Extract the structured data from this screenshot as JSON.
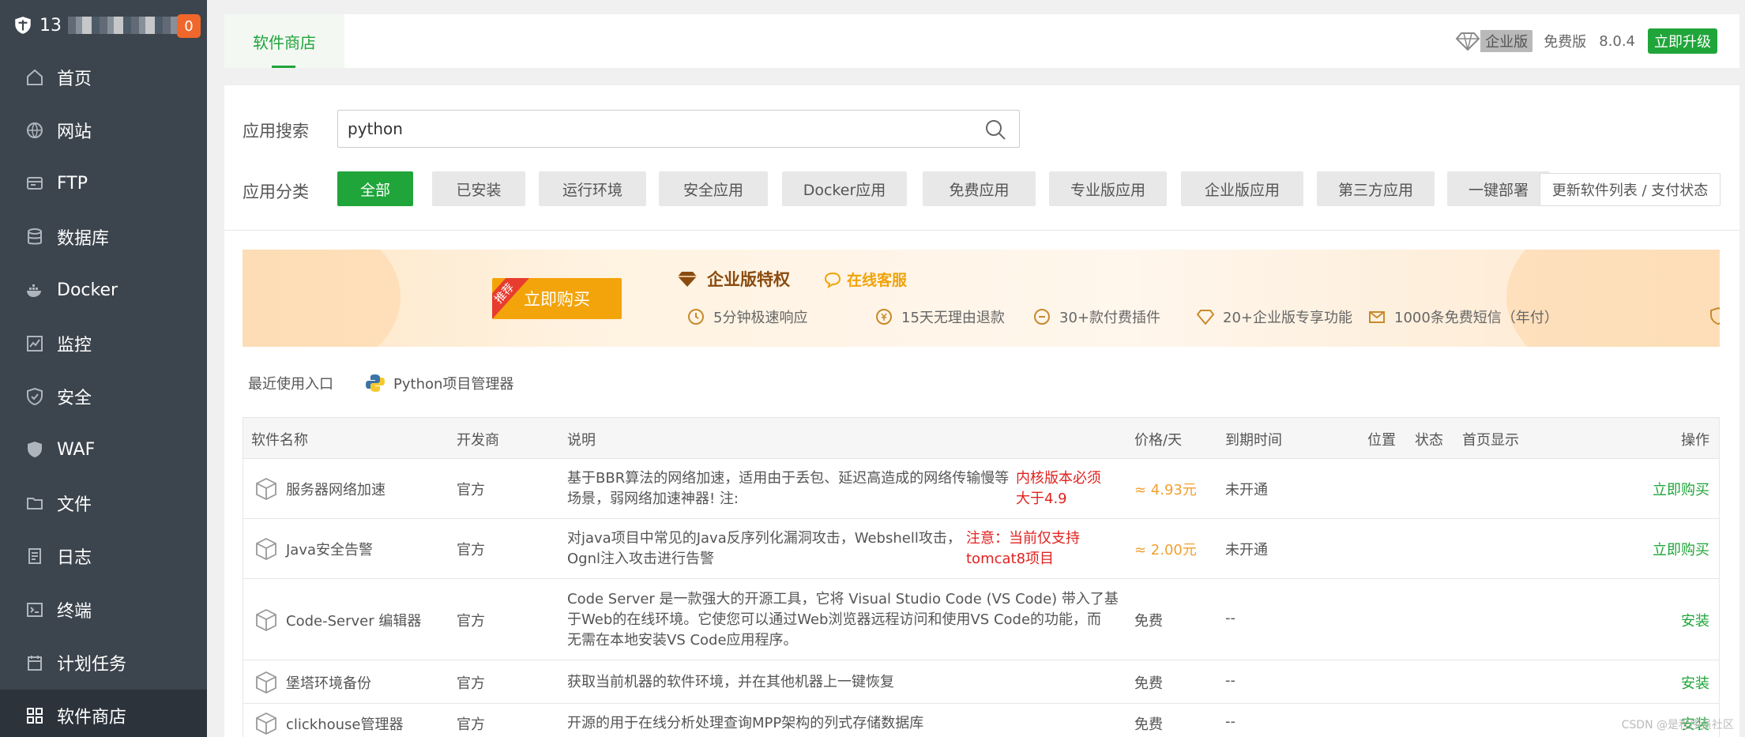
{
  "sidebar": {
    "account_prefix": "13",
    "notification_count": "0",
    "items": [
      {
        "label": "首页",
        "icon": "home-icon"
      },
      {
        "label": "网站",
        "icon": "globe-icon"
      },
      {
        "label": "FTP",
        "icon": "ftp-icon"
      },
      {
        "label": "数据库",
        "icon": "database-icon"
      },
      {
        "label": "Docker",
        "icon": "docker-icon"
      },
      {
        "label": "监控",
        "icon": "monitor-icon"
      },
      {
        "label": "安全",
        "icon": "shield-icon"
      },
      {
        "label": "WAF",
        "icon": "waf-icon"
      },
      {
        "label": "文件",
        "icon": "folder-icon"
      },
      {
        "label": "日志",
        "icon": "log-icon"
      },
      {
        "label": "终端",
        "icon": "terminal-icon"
      },
      {
        "label": "计划任务",
        "icon": "calendar-icon"
      },
      {
        "label": "软件商店",
        "icon": "store-icon"
      }
    ]
  },
  "topbar": {
    "tab": "软件商店",
    "enterprise": "企业版",
    "free": "免费版",
    "version": "8.0.4",
    "upgrade": "立即升级"
  },
  "search": {
    "label": "应用搜索",
    "value": "python"
  },
  "categories": {
    "label": "应用分类",
    "items": [
      "全部",
      "已安装",
      "运行环境",
      "安全应用",
      "Docker应用",
      "免费应用",
      "专业版应用",
      "企业版应用",
      "第三方应用",
      "一键部署"
    ],
    "refresh": "更新软件列表 / 支付状态"
  },
  "banner": {
    "ribbon": "推荐",
    "buy": "立即购买",
    "title": "企业版特权",
    "service": "在线客服",
    "features": [
      "5分钟极速响应",
      "15天无理由退款",
      "30+款付费插件",
      "20+企业版专享功能",
      "1000条免费短信（年付）"
    ]
  },
  "recent": {
    "label": "最近使用入口",
    "item": "Python项目管理器"
  },
  "table": {
    "headers": [
      "软件名称",
      "开发商",
      "说明",
      "价格/天",
      "到期时间",
      "位置",
      "状态",
      "首页显示",
      "操作"
    ],
    "rows": [
      {
        "name": "服务器网络加速",
        "vendor": "官方",
        "desc1": "基于BBR算法的网络加速，适用由于丢包、延迟高造成的网络传输慢等",
        "desc2": "场景，弱网络加速神器! 注:",
        "desc3": "",
        "note1": "内核版本必须",
        "note2": "大于4.9",
        "price": "≈ 4.93元",
        "expire": "未开通",
        "action": "立即购买"
      },
      {
        "name": "Java安全告警",
        "vendor": "官方",
        "desc1": "对java项目中常见的Java反序列化漏洞攻击，Webshell攻击，",
        "desc2": "Ognl注入攻击进行告警",
        "desc3": "",
        "note1": "注意：当前仅支持",
        "note2": "tomcat8项目",
        "price": "≈ 2.00元",
        "expire": "未开通",
        "action": "立即购买"
      },
      {
        "name": "Code-Server 编辑器",
        "vendor": "官方",
        "desc1": "Code Server 是一款强大的开源工具，它将 Visual Studio Code (VS Code) 带入了基",
        "desc2": "于Web的在线环境。它使您可以通过Web浏览器远程访问和使用VS Code的功能，而",
        "desc3": "无需在本地安装VS Code应用程序。",
        "note1": "",
        "note2": "",
        "price": "免费",
        "expire": "--",
        "action": "安装"
      },
      {
        "name": "堡塔环境备份",
        "vendor": "官方",
        "desc1": "获取当前机器的软件环境，并在其他机器上一键恢复",
        "desc2": "",
        "desc3": "",
        "note1": "",
        "note2": "",
        "price": "免费",
        "expire": "--",
        "action": "安装"
      },
      {
        "name": "clickhouse管理器",
        "vendor": "官方",
        "desc1": "开源的用于在线分析处理查询MPP架构的列式存储数据库",
        "desc2": "",
        "desc3": "",
        "note1": "",
        "note2": "",
        "price": "免费",
        "expire": "--",
        "action": "安装"
      }
    ]
  },
  "watermark": "CSDN @是程序员社区",
  "colors": {
    "accent": "#20a53a",
    "sidebar": "#3c444d",
    "badge": "#f0672b",
    "banner_button": "#f3a40b",
    "warning_text": "#e0231f"
  }
}
